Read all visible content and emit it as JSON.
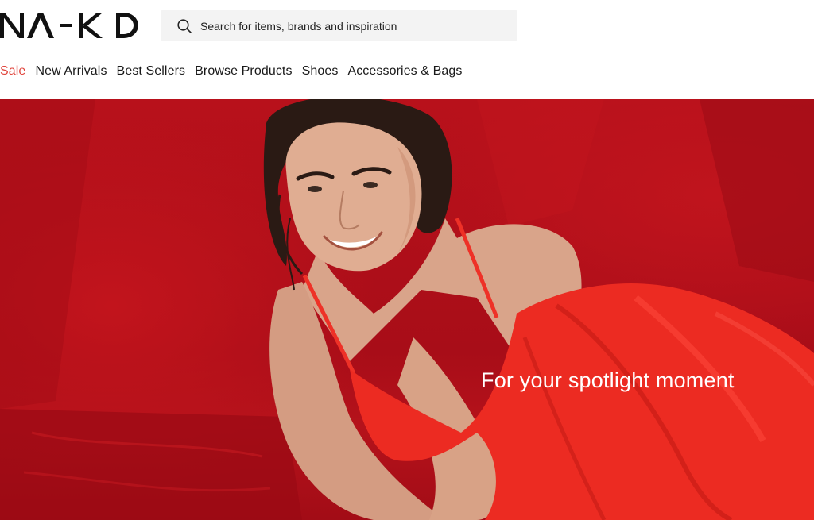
{
  "brand": {
    "logo_text": "NA-KD"
  },
  "search": {
    "placeholder": "Search for items, brands and inspiration",
    "icon": "search-icon"
  },
  "nav": {
    "items": [
      {
        "label": "Sale",
        "highlight": true
      },
      {
        "label": "New Arrivals"
      },
      {
        "label": "Best Sellers"
      },
      {
        "label": "Browse Products"
      },
      {
        "label": "Shoes"
      },
      {
        "label": "Accessories & Bags"
      }
    ]
  },
  "hero": {
    "caption": "For your spotlight moment"
  },
  "colors": {
    "sale": "#e0443c",
    "hero_bg": "#b3111b",
    "dress": "#ee2e24",
    "text": "#1a1a1a"
  }
}
